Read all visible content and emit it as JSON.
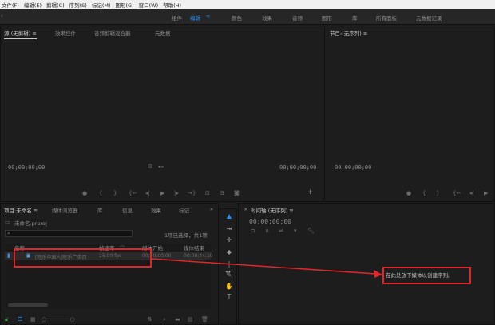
{
  "menubar": [
    "文件(F)",
    "编辑(E)",
    "剪辑(C)",
    "序列(S)",
    "标记(M)",
    "图形(G)",
    "窗口(W)",
    "帮助(H)"
  ],
  "workspaces": {
    "items": [
      "组件",
      "编辑",
      "颜色",
      "效果",
      "音频",
      "图形",
      "库",
      "所有面板",
      "元数据记录"
    ],
    "menu_glyph": "≡"
  },
  "source_panel": {
    "tabs": [
      "源:(无剪辑)",
      "效果控件",
      "音频剪辑混合器",
      "元数据"
    ],
    "tab_menu": "≡",
    "timecode_left": "00;00;00;00",
    "timecode_right": "00;00;00;00"
  },
  "program_panel": {
    "tab": "节目:(无序列)",
    "tab_menu": "≡",
    "timecode_left": "00;00;00;00"
  },
  "project_panel": {
    "tabs": [
      "项目:未命名",
      "媒体浏览器",
      "库",
      "信息",
      "效果",
      "标记"
    ],
    "tab_menu": "≡",
    "expand_glyph": "»",
    "file_name": "未命名.prproj",
    "selection_info": "1项已选择，共1项",
    "columns": [
      "名称",
      "帧速率",
      "媒体开始",
      "媒体结束"
    ],
    "row": {
      "name": "[吃乐中国人]吃乐广告西",
      "fps": "25.00 fps",
      "start": "00;00;00;00",
      "end": "00;00;44;19"
    }
  },
  "timeline_panel": {
    "close": "×",
    "tab": "时间轴:(无序列)",
    "tab_menu": "≡",
    "timecode": "00;00;00;00",
    "drop_hint": "在此处放下媒体以创建序列。"
  },
  "colors": {
    "accent": "#2d8ceb",
    "annotation": "#e0262b"
  }
}
